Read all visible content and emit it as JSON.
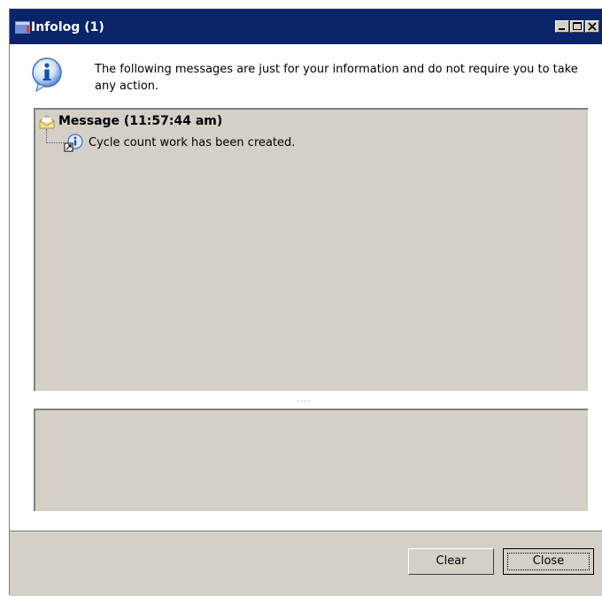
{
  "window": {
    "title": "Infolog (1)",
    "titlebar_color": "#0a246a",
    "controls": [
      "minimize-icon",
      "maximize-icon",
      "close-icon"
    ]
  },
  "info": {
    "icon": "info-icon",
    "text": "The following messages are just for your information and do not require you to take any action."
  },
  "messages": {
    "header": {
      "icon": "envelope-icon",
      "label": "Message (11:57:44 am)"
    },
    "items": [
      {
        "icon": "info-small-icon",
        "text": "Cycle count work has been created."
      }
    ]
  },
  "splitter": {
    "grip": "...."
  },
  "buttons": {
    "clear": "Clear",
    "close": "Close"
  }
}
